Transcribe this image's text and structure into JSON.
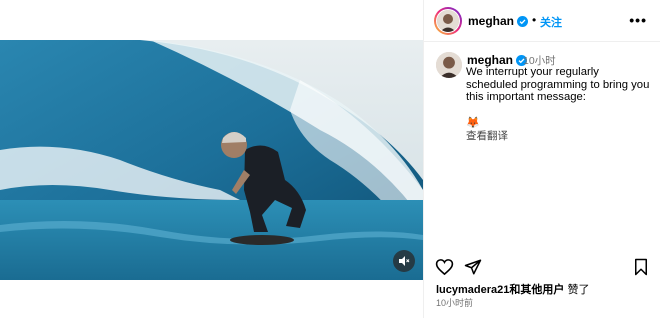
{
  "media": {
    "mute_icon": "speaker-muted-icon"
  },
  "header": {
    "username": "meghan",
    "follow_label": "关注",
    "more_icon": "more-horizontal-icon"
  },
  "caption": {
    "username": "meghan",
    "time": "10小时",
    "text": "We interrupt your regularly scheduled programming to bring you this important message:",
    "emoji": "🦊",
    "translate_label": "查看翻译"
  },
  "actions": {
    "like_icon": "heart-icon",
    "share_icon": "send-icon",
    "save_icon": "bookmark-icon"
  },
  "likes": {
    "user": "lucymadera21",
    "text": "和其他用户",
    "tail": " 赞了"
  },
  "post_time": "10小时前",
  "colors": {
    "follow": "#0095f6",
    "verified": "#0095f6",
    "secondary_text": "#737373",
    "divider": "#efefef"
  }
}
